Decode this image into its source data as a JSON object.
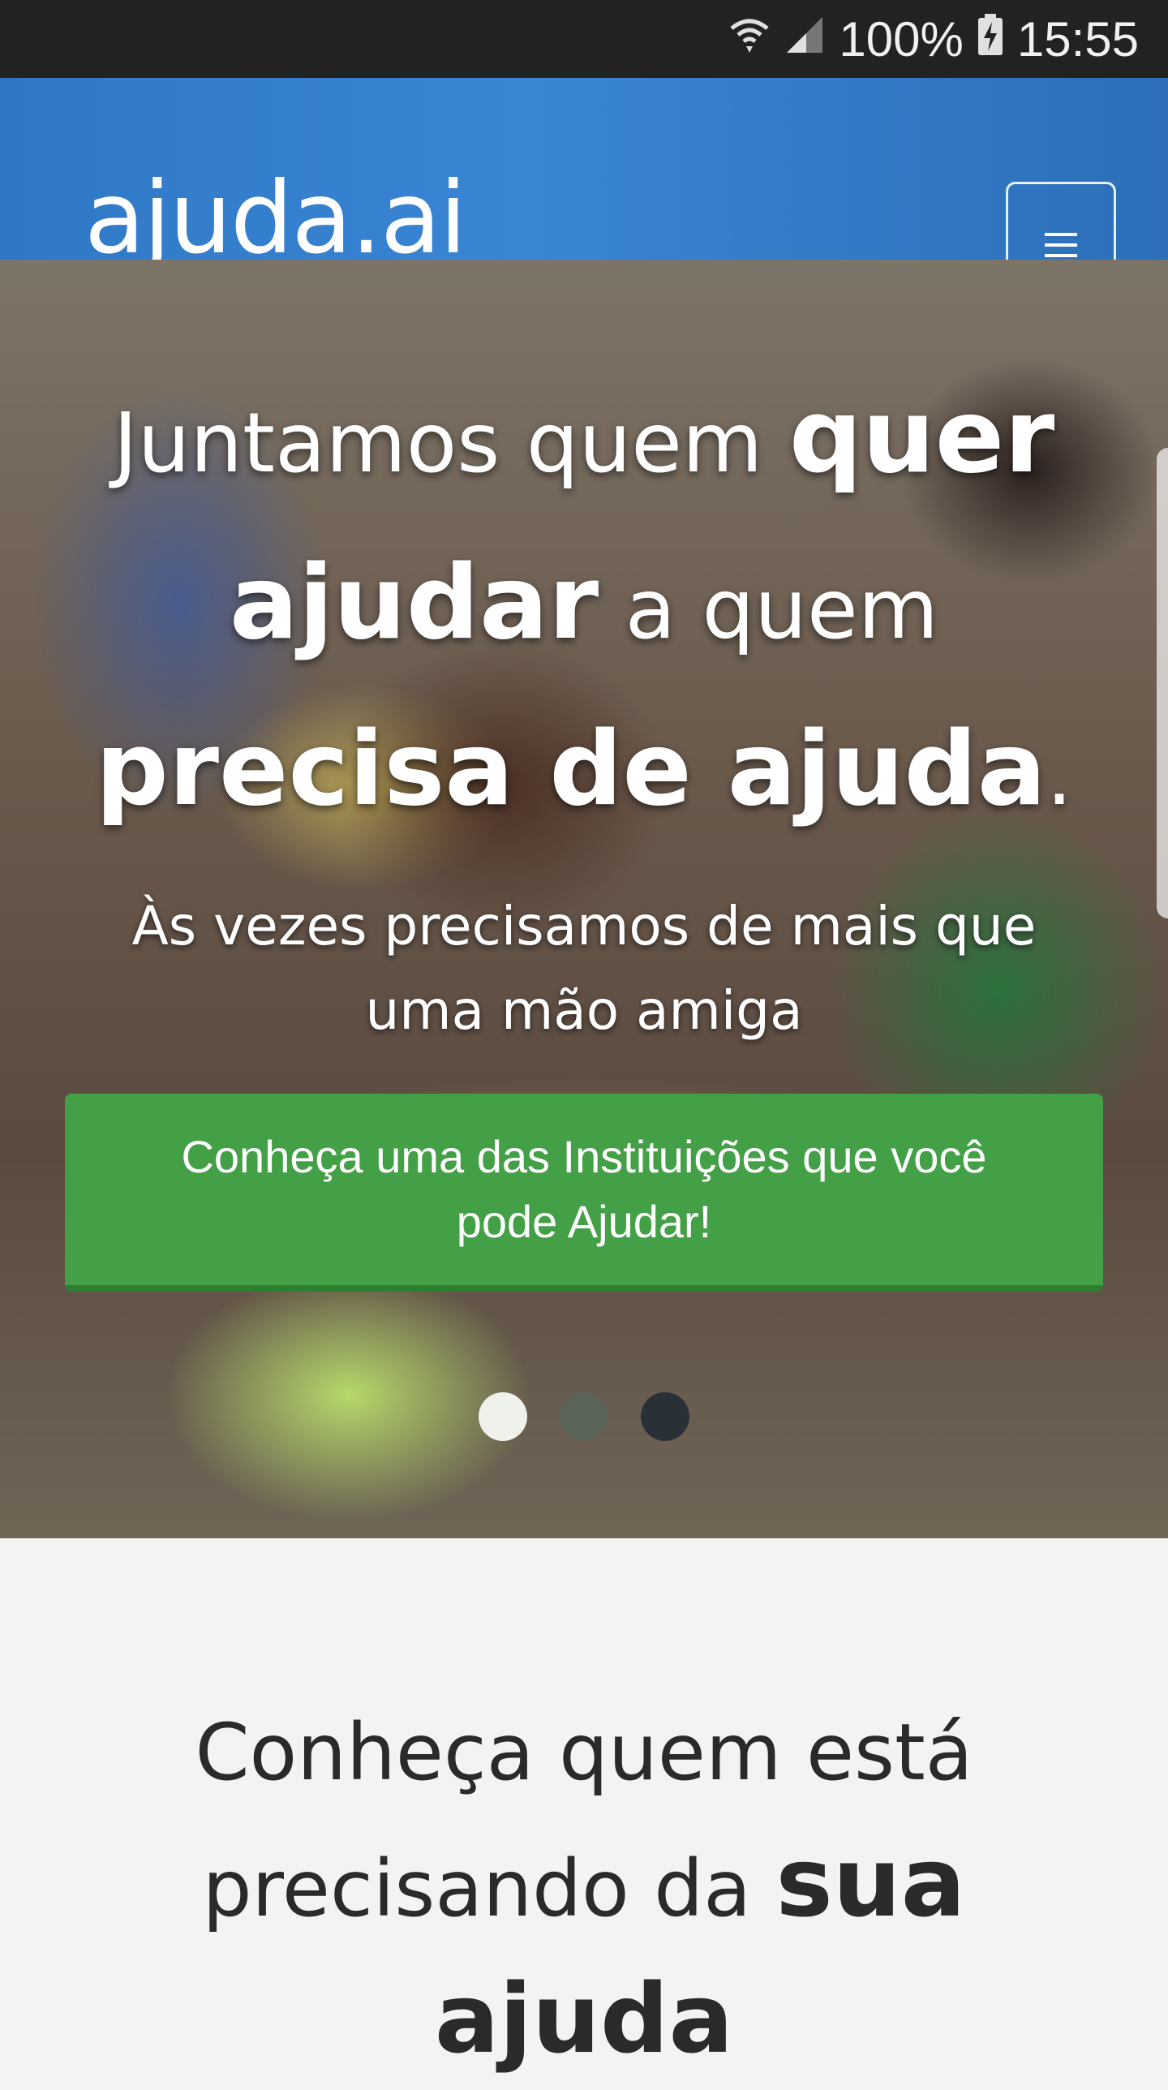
{
  "status_bar": {
    "battery": "100%",
    "time": "15:55"
  },
  "navbar": {
    "logo": "ajuda.ai"
  },
  "hero": {
    "headline": {
      "part1": "Juntamos quem ",
      "bold1": "quer ajudar",
      "part2": " a quem ",
      "bold2": "precisa de ajuda",
      "part3": "."
    },
    "subheadline": "Às vezes precisamos de mais que uma mão amiga",
    "cta_label": "Conheça uma das Instituições que você pode Ajudar!",
    "carousel": {
      "slide_count": 3,
      "active_index": 0
    }
  },
  "section": {
    "title_part1": "Conheça quem está precisando da ",
    "title_bold": "sua ajuda"
  }
}
